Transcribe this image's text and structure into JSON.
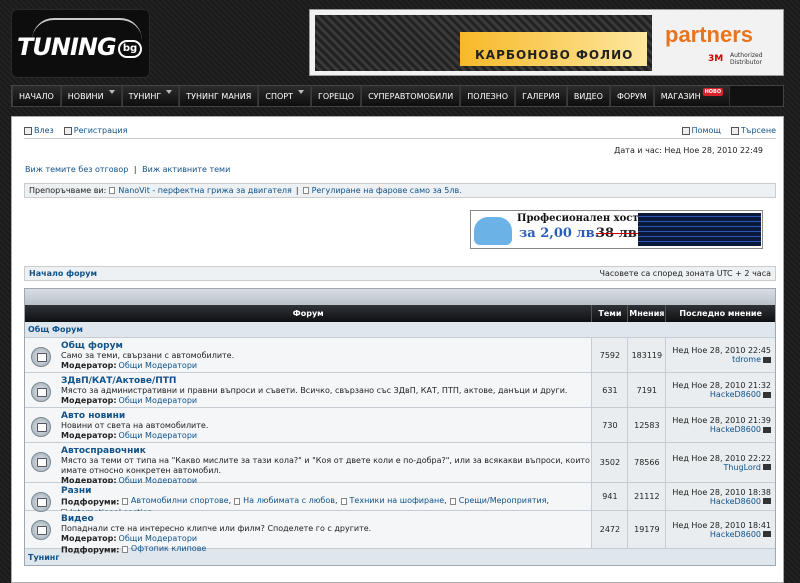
{
  "header": {
    "logo_text": "TUNING",
    "logo_badge": "bg",
    "banner_text": "КАРБОНОВО ФОЛИО",
    "banner_brand": "partners",
    "banner_3m": "3M",
    "banner_sub": "Authorized Distributor"
  },
  "nav": {
    "items": [
      {
        "label": "НАЧАЛО",
        "arrow": false
      },
      {
        "label": "НОВИНИ",
        "arrow": true
      },
      {
        "label": "ТУНИНГ",
        "arrow": true
      },
      {
        "label": "ТУНИНГ МАНИЯ",
        "arrow": false
      },
      {
        "label": "СПОРТ",
        "arrow": true
      },
      {
        "label": "ГОРЕЩО",
        "arrow": false
      },
      {
        "label": "СУПЕРАВТОМОБИЛИ",
        "arrow": false
      },
      {
        "label": "ПОЛЕЗНО",
        "arrow": false
      },
      {
        "label": "ГАЛЕРИЯ",
        "arrow": false
      },
      {
        "label": "ВИДЕО",
        "arrow": false
      },
      {
        "label": "ФОРУМ",
        "arrow": false
      },
      {
        "label": "МАГАЗИН",
        "arrow": false
      }
    ],
    "new_badge": "НОВО"
  },
  "topbar": {
    "login": "Влез",
    "register": "Регистрация",
    "help": "Помощ",
    "search": "Търсене"
  },
  "datetime": "Дата и час: Нед Ное 28, 2010 22:49",
  "quicklinks": {
    "unanswered": "Виж темите без отговор",
    "sep": "|",
    "active": "Виж активните теми"
  },
  "recommend": {
    "label": "Препоръчваме ви:",
    "link1": "NanoVit - перфектна грижа за двигателя",
    "sep": "|",
    "link2": "Регулиране на фарове само за 5лв."
  },
  "hosting": {
    "title": "Професионален хостинг",
    "price": "за 2,00 лв.",
    "old_price": "38 лв."
  },
  "breadcrumb": {
    "home": "Начало форум",
    "timezone": "Часовете са според зоната UTC + 2 часа"
  },
  "table": {
    "headers": {
      "forum": "Форум",
      "topics": "Теми",
      "posts": "Мнения",
      "last": "Последно мнение"
    },
    "category": "Общ Форум",
    "next_category": "Тунинг",
    "moderator_label": "Модератор:",
    "subforums_label": "Подфоруми:",
    "forums": [
      {
        "title": "Общ форум",
        "desc": "Само за теми, свързани с автомобилите.",
        "moderator": "Общи Модератори",
        "topics": "7592",
        "posts": "183119",
        "last_date": "Нед Ное 28, 2010 22:45",
        "last_user": "tdrome"
      },
      {
        "title": "ЗДвП/КАТ/Актове/ПТП",
        "desc": "Място за административни и правни въпроси и съвети. Всичко, свързано със ЗДвП, КАТ, ПТП, актове, данъци и други.",
        "moderator": "Общи Модератори",
        "topics": "631",
        "posts": "7191",
        "last_date": "Нед Ное 28, 2010 21:32",
        "last_user": "HackeD8600"
      },
      {
        "title": "Авто новини",
        "desc": "Новини от света на автомобилите.",
        "moderator": "Общи Модератори",
        "topics": "730",
        "posts": "12583",
        "last_date": "Нед Ное 28, 2010 21:39",
        "last_user": "HackeD8600"
      },
      {
        "title": "Автосправочник",
        "desc": "Място за теми от типа на \"Какво мислите за тази кола?\" и \"Коя от двете коли е по-добра?\", или за всякакви въпроси, които имате относно конкретен автомобил.",
        "moderator": "Общи Модератори",
        "topics": "3502",
        "posts": "78566",
        "last_date": "Нед Ное 28, 2010 22:22",
        "last_user": "ThugLord"
      },
      {
        "title": "Разни",
        "subforums": [
          "Автомобилни спортове",
          "На любимата с любов",
          "Техники на шофиране",
          "Срещи/Мероприятия",
          "International section"
        ],
        "topics": "941",
        "posts": "21112",
        "last_date": "Нед Ное 28, 2010 18:38",
        "last_user": "HackeD8600"
      },
      {
        "title": "Видео",
        "desc": "Попаднали сте на интересно клипче или филм? Споделете го с другите.",
        "moderator": "Общи Модератори",
        "subforums": [
          "Офтопик клипове"
        ],
        "topics": "2472",
        "posts": "19179",
        "last_date": "Нед Ное 28, 2010 18:41",
        "last_user": "HackeD8600"
      }
    ]
  }
}
